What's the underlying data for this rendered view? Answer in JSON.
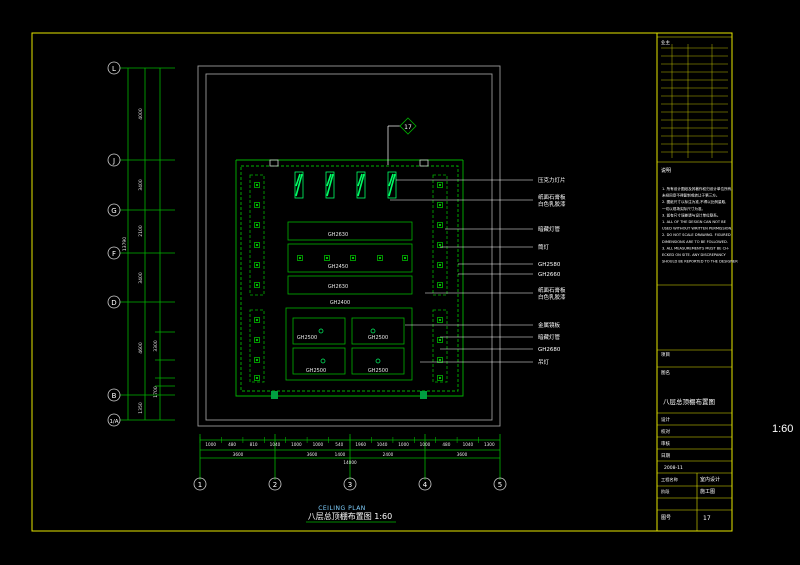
{
  "colors": {
    "background": "#000000",
    "frame": "#e6e600",
    "grid": "#00b400",
    "wall": "#9a9a9a",
    "light": "#00ff66",
    "leader": "#ffffff",
    "text": "#ffffff"
  },
  "scale_side": "1:60",
  "plan": {
    "caption_en": "CEILING  PLAN",
    "caption_cn": "八层总顶棚布置图 1:60"
  },
  "row_axes": [
    "L",
    "J",
    "G",
    "F",
    "D",
    "B",
    "1/A"
  ],
  "col_axes": [
    "1",
    "2",
    "3",
    "4",
    "5"
  ],
  "left_dims": [
    "4000",
    "3400",
    "2100",
    "3400",
    "4600",
    "3300",
    "1700",
    "1350",
    "13790"
  ],
  "bottom_dims_top": [
    "1000",
    "480",
    "810",
    "1040",
    "1000",
    "1000",
    "540",
    "1960",
    "1040",
    "1000",
    "1000",
    "480",
    "1040",
    "1300"
  ],
  "bottom_dims_mid": [
    "3600",
    "3600",
    "1400",
    "2400",
    "3600"
  ],
  "bottom_dims_total": "14000",
  "ceiling_labels": [
    "GH2630",
    "GH2450",
    "GH2630",
    "GH2400",
    "GH2500",
    "GH2500",
    "GH2500",
    "GH2500"
  ],
  "elevation_mark": "17",
  "callouts": [
    "压克力灯片",
    "纸面石膏板",
    "白色乳胶漆",
    "暗藏灯管",
    "筒灯",
    "GH2580",
    "GH2660",
    "纸面石膏板",
    "白色乳胶漆",
    "金属镜板",
    "暗藏灯管",
    "GH2680",
    "吊灯"
  ],
  "title_block": {
    "top_label": "业主",
    "notes_title": "说明",
    "notes": [
      "1. 所有设计图纸及其著作权归设计单位所有,",
      "   未经同意不得复制或转让于第三方。",
      "2. 图纸尺寸以标注为准,不得以比例量取,",
      "   一切以现场实际尺寸为准。",
      "3. 如有尺寸误差请与设计单位联系。",
      "1. ALL OF THE DESIGN CAN NOT BE",
      "   USED WITHOUT WRITTEN PERMISSION.",
      "2. DO NOT SCALE DRAWING. FIGURED",
      "   DIMENSIONS ARE TO BE FOLLOWED.",
      "3. ALL MEASUREMENTS MUST BE CH-",
      "   ECKED ON SITE. ANY DISCREPANCY",
      "   SHOULD BE REPORTED TO THE DESIGNER"
    ],
    "project_label": "项目",
    "drawing_label": "图名",
    "drawing_name": "八层总顶棚布置图",
    "designer_label": "设计",
    "checker_label": "校对",
    "approver_label": "审核",
    "date_label": "日期",
    "date_value": "2008-11",
    "phase_label": "工程名称",
    "phase_value": "室内设计",
    "stage_label": "阶段",
    "stage_value": "施工图",
    "sheet_label": "图号",
    "sheet_value": "17"
  }
}
